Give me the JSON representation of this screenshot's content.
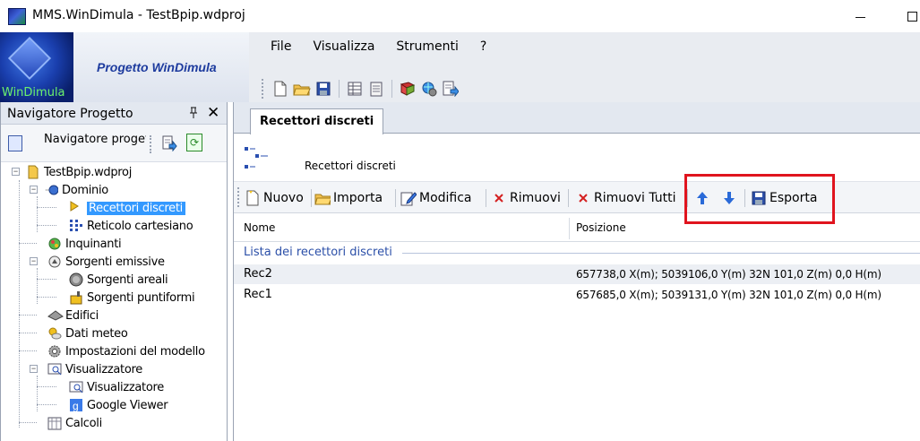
{
  "window": {
    "title": "MMS.WinDimula - TestBpip.wdproj",
    "minimize_glyph": "☐",
    "minimize_label": "—"
  },
  "header": {
    "logo_text": "WinDimula",
    "project_title": "Progetto WinDimula",
    "menu": [
      "File",
      "Visualizza",
      "Strumenti",
      "?"
    ]
  },
  "left_panel": {
    "title": "Navigatore Progetto",
    "pin_glyph": "Ⅎ",
    "close_glyph": "✕",
    "nav_label": "Navigatore progetto",
    "tree": {
      "root": "TestBpip.wdproj",
      "dominio": "Dominio",
      "recettori": "Recettori discreti",
      "reticolo": "Reticolo cartesiano",
      "inquinanti": "Inquinanti",
      "sorgenti": "Sorgenti emissive",
      "areali": "Sorgenti areali",
      "puntiformi": "Sorgenti puntiformi",
      "edifici": "Edifici",
      "meteo": "Dati meteo",
      "impostazioni": "Impostazioni del modello",
      "visualizzatore": "Visualizzatore",
      "visualizzatore_child": "Visualizzatore",
      "google": "Google Viewer",
      "calcoli": "Calcoli"
    }
  },
  "right_panel": {
    "tab_label": "Recettori discreti",
    "section_title": "Recettori discreti",
    "actions": {
      "nuovo": "Nuovo",
      "importa": "Importa",
      "modifica": "Modifica",
      "rimuovi": "Rimuovi",
      "rimuovi_tutti": "Rimuovi Tutti",
      "esporta": "Esporta"
    },
    "columns": [
      "Nome",
      "Posizione"
    ],
    "group_label": "Lista dei recettori discreti",
    "rows": [
      {
        "nome": "Rec2",
        "posizione": "657738,0 X(m); 5039106,0 Y(m) 32N  101,0 Z(m) 0,0 H(m)"
      },
      {
        "nome": "Rec1",
        "posizione": "657685,0 X(m); 5039131,0 Y(m) 32N  101,0 Z(m) 0,0 H(m)"
      }
    ]
  },
  "colors": {
    "selection": "#3399ff",
    "highlight_box": "#e0141e",
    "group_text": "#2b4fa8"
  }
}
